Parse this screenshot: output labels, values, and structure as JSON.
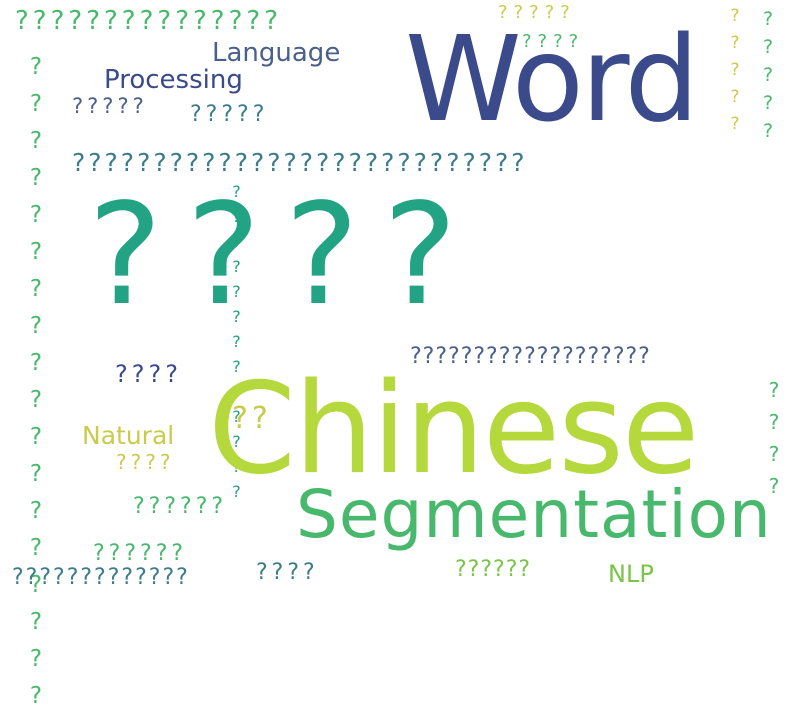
{
  "colors": {
    "background": "#ffffff",
    "navy": "#3a4a8a",
    "slate": "#4a5f8a",
    "teal_blue": "#3b7c8c",
    "teal": "#22a383",
    "green": "#48b86c",
    "light_green": "#7ac448",
    "lime": "#b5d83c",
    "olive": "#c8cc4a"
  },
  "words": {
    "w01": "???????????????",
    "w02": "?????",
    "w03": "????",
    "w04": "Language",
    "w05": "Processing",
    "w06": "Word",
    "w07": "?????",
    "w08": "?????",
    "w09": "????????????????????????????",
    "w10": "????",
    "w11": "???????????????????",
    "w12": "????",
    "w13": "Chinese",
    "w14": "??",
    "w15": "Natural",
    "w16": "????",
    "w17": "??????",
    "w18": "Segmentation",
    "w19": "??????",
    "w20": "?????????????",
    "w21": "????",
    "w22": "??????",
    "w23": "NLP",
    "v01": "??????????????????",
    "v02": "?????????????",
    "v03": "?????",
    "v04": "?????",
    "v05": "????"
  }
}
